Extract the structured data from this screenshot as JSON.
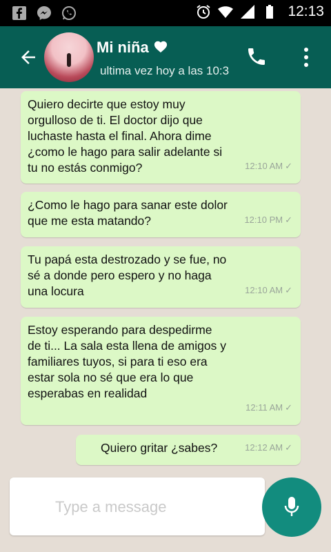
{
  "status_bar": {
    "time": "12:13",
    "icons": [
      "facebook-icon",
      "messenger-icon",
      "whatsapp-icon",
      "alarm-icon",
      "wifi-icon",
      "signal-icon",
      "battery-icon"
    ]
  },
  "header": {
    "contact_name": "Mi niña",
    "heart": "❤",
    "last_seen": "ultima vez hoy a las 10:3"
  },
  "messages": [
    {
      "text": "Quiero decirte que estoy muy orgulloso de ti. El doctor dijo que luchaste hasta el final. Ahora dime ¿como le hago para salir adelante si tu no estás conmigo?",
      "time": "12:10 AM",
      "tick": "✓"
    },
    {
      "text": "¿Como le hago para sanar este dolor que me esta matando?",
      "time": "12:10 PM",
      "tick": "✓"
    },
    {
      "text": "Tu papá esta destrozado y se fue, no sé a donde pero espero y no haga una locura",
      "time": "12:10 AM",
      "tick": "✓"
    },
    {
      "text": "Estoy esperando para despedirme de ti... La sala esta llena de amigos y familiares tuyos, si para ti eso era estar sola no sé que era lo que esperabas en realidad",
      "time": "12:11 AM",
      "tick": "✓"
    },
    {
      "text": "Quiero gritar ¿sabes?",
      "time": "12:12 AM",
      "tick": "✓"
    }
  ],
  "composer": {
    "placeholder": "Type a message"
  },
  "colors": {
    "header": "#075e54",
    "bubble": "#dcf8c6",
    "chat_bg": "#e5ddd5",
    "mic_button": "#128c7e"
  }
}
